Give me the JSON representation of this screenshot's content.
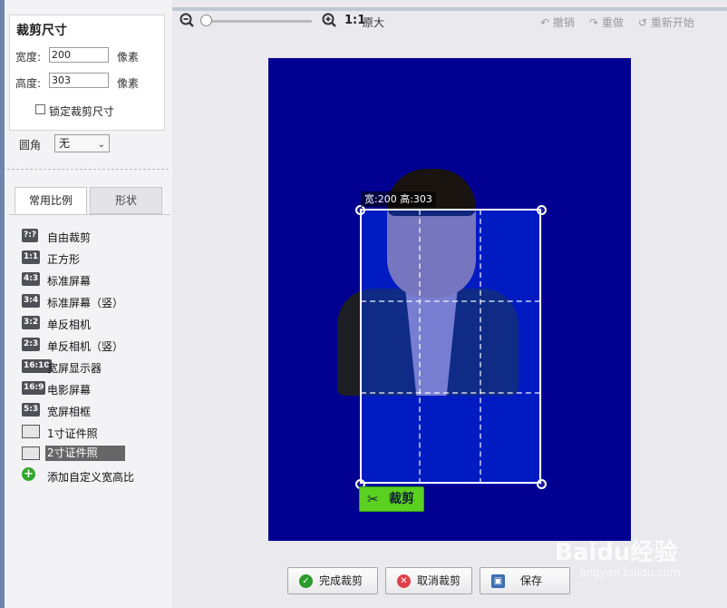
{
  "crop_size": {
    "title": "裁剪尺寸",
    "width_label": "宽度:",
    "width_value": "200",
    "height_label": "高度:",
    "height_value": "303",
    "unit": "像素",
    "lock_label": "锁定裁剪尺寸",
    "lock_checked": false
  },
  "corner": {
    "label": "圆角",
    "value": "无"
  },
  "tabs": [
    {
      "label": "常用比例",
      "active": true
    },
    {
      "label": "形状",
      "active": false
    }
  ],
  "ratios": [
    {
      "badge": "?:?",
      "label": "自由裁剪"
    },
    {
      "badge": "1:1",
      "label": "正方形"
    },
    {
      "badge": "4:3",
      "label": "标准屏幕"
    },
    {
      "badge": "3:4",
      "label": "标准屏幕（竖）"
    },
    {
      "badge": "3:2",
      "label": "单反相机"
    },
    {
      "badge": "2:3",
      "label": "单反相机（竖）"
    },
    {
      "badge": "16:10",
      "label": "宽屏显示器"
    },
    {
      "badge": "16:9",
      "label": "电影屏幕"
    },
    {
      "badge": "5:3",
      "label": "宽屏相框"
    },
    {
      "badge": "id-card-icon",
      "label": "1寸证件照"
    },
    {
      "badge": "id-card-icon",
      "label": "2寸证件照",
      "selected": true
    },
    {
      "badge": "plus-icon",
      "label": "添加自定义宽高比"
    }
  ],
  "toolbar": {
    "zoom_level": 0,
    "ratio_text": "1:1",
    "original_label": "原大",
    "undo_label": "撤销",
    "redo_label": "重做",
    "restart_label": "重新开始"
  },
  "canvas": {
    "background": "#010091",
    "crop_dimension_text": "宽:200 高:303",
    "crop_button_label": "裁剪"
  },
  "buttons": {
    "finish_label": "完成裁剪",
    "cancel_label": "取消裁剪",
    "save_label": "保存"
  },
  "watermark": {
    "text": "Baidu经验",
    "url": "jingyan.baidu.com"
  },
  "colors": {
    "accent_green": "#5bd11f",
    "cancel_red": "#e0404a",
    "finish_green": "#2a9a2a"
  }
}
